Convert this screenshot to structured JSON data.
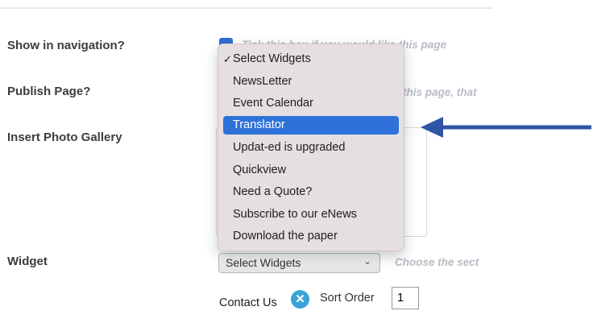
{
  "form": {
    "show_in_nav": {
      "label": "Show in navigation?",
      "hint": "Tick this box if you would like this page"
    },
    "publish": {
      "label": "Publish Page?",
      "hint": "this page, that"
    },
    "gallery": {
      "label": "Insert Photo Gallery"
    },
    "widget": {
      "label": "Widget",
      "selected": "Select Widgets",
      "hint": "Choose the sect",
      "options": [
        "Select Widgets",
        "NewsLetter",
        "Event Calendar",
        "Translator",
        "Updat-ed is upgraded",
        "Quickview",
        "Need a Quote?",
        "Subscribe to our eNews",
        "Download the paper"
      ],
      "checked_index": 0,
      "highlighted_index": 3
    },
    "contact": {
      "label": "Contact Us",
      "sort_label": "Sort Order",
      "sort_value": "1"
    }
  },
  "colors": {
    "highlight": "#2e72d9",
    "arrow": "#2f56a4",
    "checkbox": "#2f6ed6"
  },
  "icons": {
    "check": "✓",
    "remove": "x-circle-icon",
    "chevron": "chevron-down-icon"
  }
}
